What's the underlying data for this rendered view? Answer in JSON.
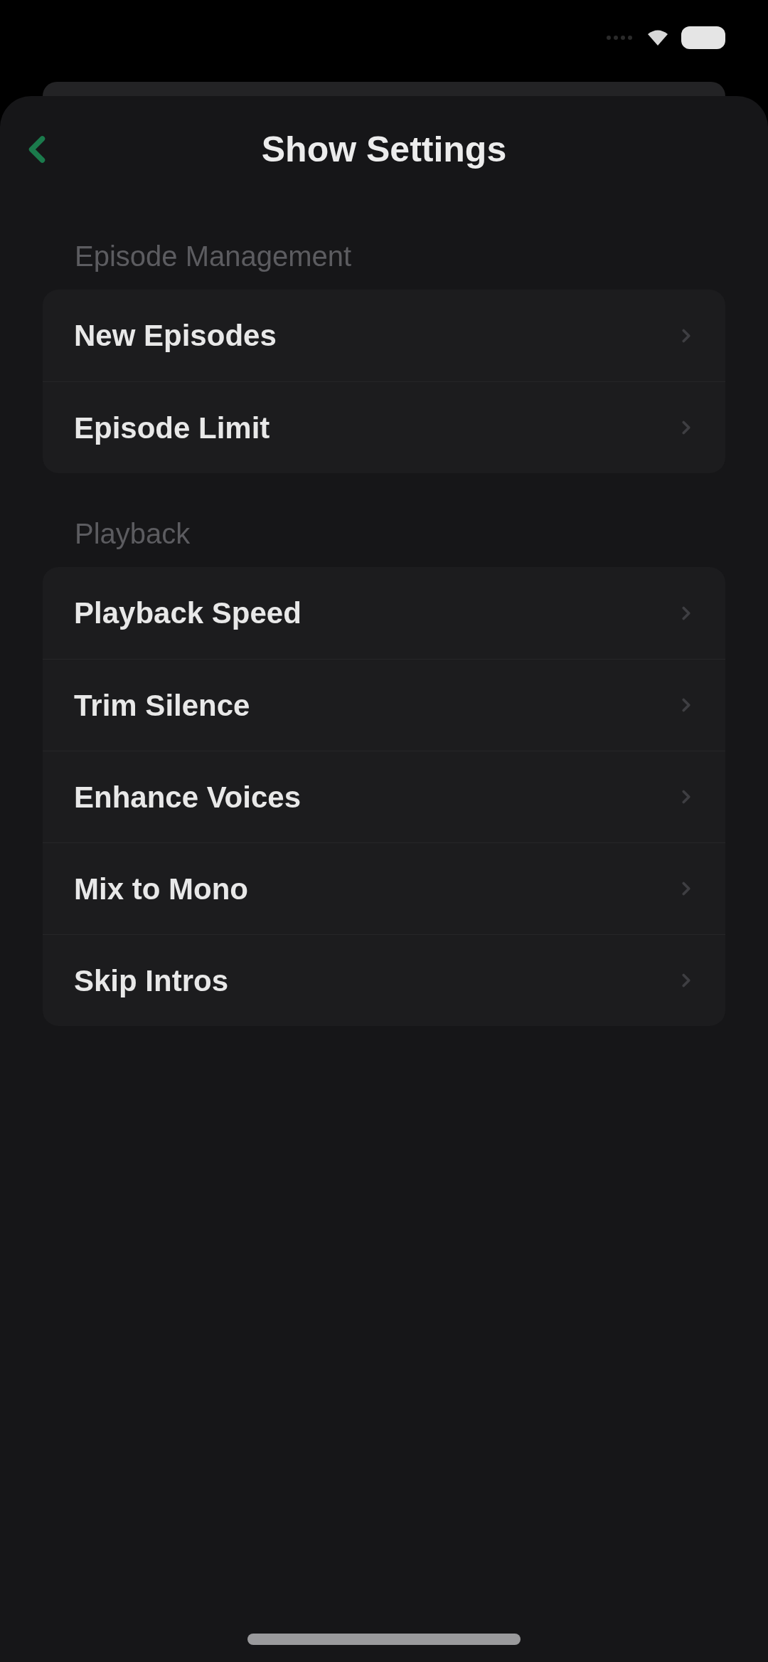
{
  "header": {
    "title": "Show Settings"
  },
  "sections": [
    {
      "title": "Episode Management",
      "rows": [
        {
          "label": "New Episodes"
        },
        {
          "label": "Episode Limit"
        }
      ]
    },
    {
      "title": "Playback",
      "rows": [
        {
          "label": "Playback Speed"
        },
        {
          "label": "Trim Silence"
        },
        {
          "label": "Enhance Voices"
        },
        {
          "label": "Mix to Mono"
        },
        {
          "label": "Skip Intros"
        }
      ]
    }
  ]
}
